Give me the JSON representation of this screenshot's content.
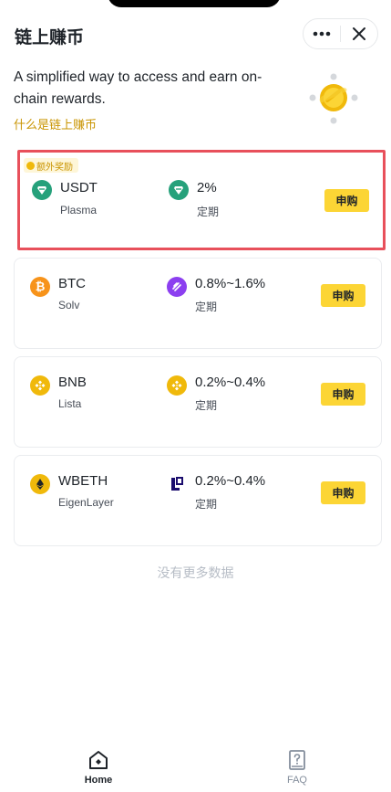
{
  "header": {
    "title": "链上赚币",
    "more_icon": "more-dots-icon",
    "close_icon": "close-icon"
  },
  "intro": {
    "text": "A simplified way to access and earn on-chain rewards.",
    "link": "什么是链上赚币"
  },
  "products": [
    {
      "bonus_tag": "额外奖励",
      "asset": "USDT",
      "protocol": "Plasma",
      "apr": "2%",
      "term": "定期",
      "button": "申购",
      "asset_icon": "usdt-icon",
      "reward_icon": "usdt-icon",
      "asset_color": "#26a17b",
      "reward_color": "#26a17b"
    },
    {
      "asset": "BTC",
      "protocol": "Solv",
      "apr": "0.8%~1.6%",
      "term": "定期",
      "button": "申购",
      "asset_icon": "btc-icon",
      "reward_icon": "solv-icon",
      "asset_color": "#f7931a",
      "reward_color": "#8c3ff0"
    },
    {
      "asset": "BNB",
      "protocol": "Lista",
      "apr": "0.2%~0.4%",
      "term": "定期",
      "button": "申购",
      "asset_icon": "bnb-icon",
      "reward_icon": "bnb-icon",
      "asset_color": "#f0b90b",
      "reward_color": "#f0b90b"
    },
    {
      "asset": "WBETH",
      "protocol": "EigenLayer",
      "apr": "0.2%~0.4%",
      "term": "定期",
      "button": "申购",
      "asset_icon": "wbeth-icon",
      "reward_icon": "eigenlayer-icon",
      "asset_color": "#f0b90b",
      "reward_color": "#1a0c6d"
    }
  ],
  "footer_note": "没有更多数据",
  "tabbar": {
    "home_label": "Home",
    "faq_label": "FAQ"
  },
  "colors": {
    "accent": "#fcd535",
    "link": "#c99400",
    "highlight_border": "#e8505b"
  }
}
